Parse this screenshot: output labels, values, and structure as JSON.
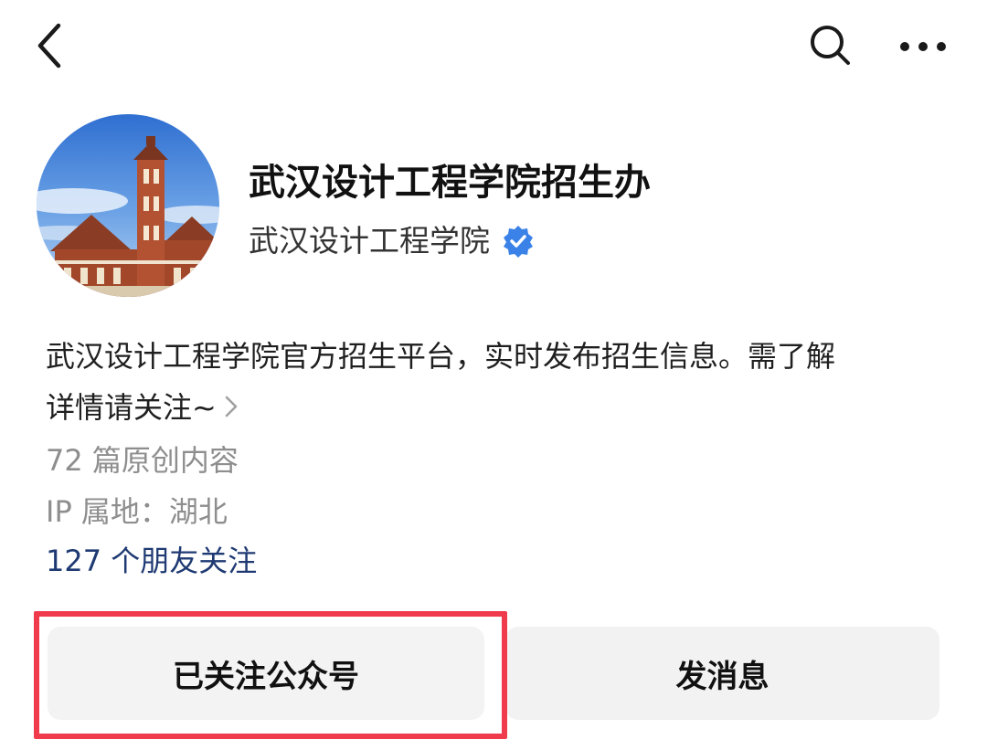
{
  "header": {
    "back_icon": "chevron-left-icon",
    "search_icon": "search-icon",
    "more_icon": "more-horizontal-icon"
  },
  "profile": {
    "avatar_icon": "building-photo-avatar",
    "account_name": "武汉设计工程学院招生办",
    "owner_name": "武汉设计工程学院",
    "verified_icon": "verified-badge-icon",
    "verified_color": "#3b82e8",
    "description_line1": "武汉设计工程学院官方招生平台，实时发布招生信息。需了解",
    "description_line2": "详情请关注~",
    "articles": "72 篇原创内容",
    "ip_location": "IP 属地：湖北",
    "friends_following": "127 个朋友关注",
    "friends_color": "#1f3a73"
  },
  "actions": {
    "followed_label": "已关注公众号",
    "message_label": "发消息",
    "highlight_color": "#ef3b4c"
  }
}
